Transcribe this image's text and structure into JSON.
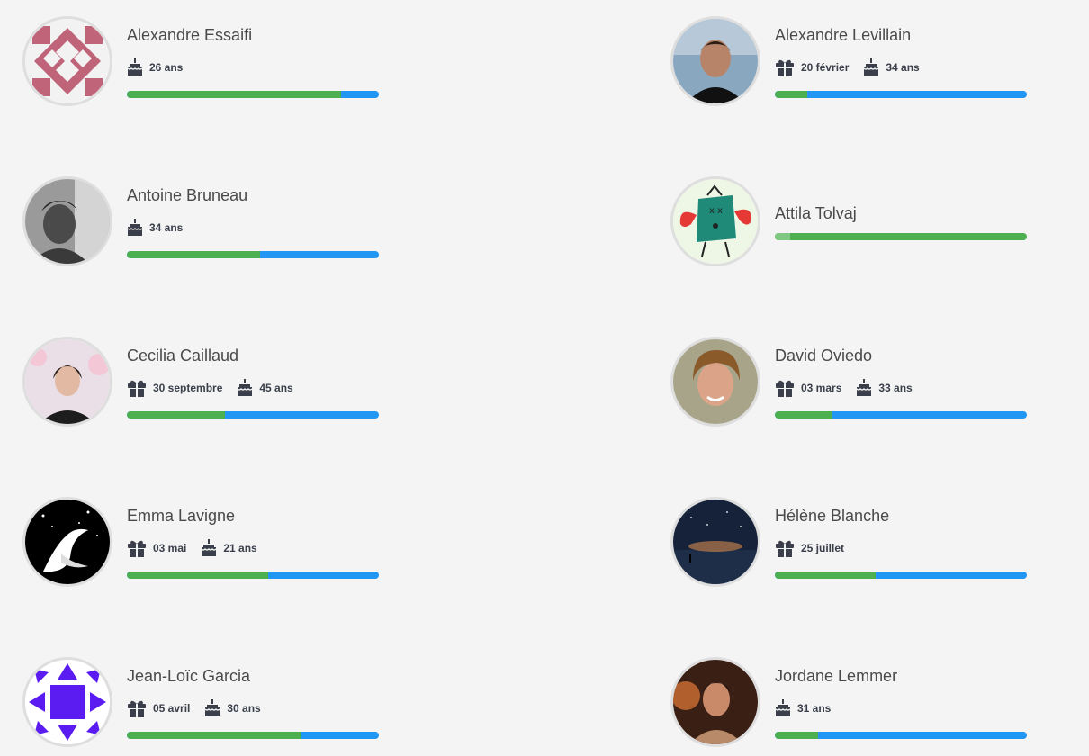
{
  "people": [
    {
      "name": "Alexandre Essaifi",
      "birthday": "",
      "age": "26 ans",
      "progress": 0.85
    },
    {
      "name": "Alexandre Levillain",
      "birthday": "20 février",
      "age": "34 ans",
      "progress": 0.13
    },
    {
      "name": "Antoine Bruneau",
      "birthday": "",
      "age": "34 ans",
      "progress": 0.53
    },
    {
      "name": "Attila Tolvaj",
      "birthday": "",
      "age": "",
      "progress": 1.0
    },
    {
      "name": "Cecilia Caillaud",
      "birthday": "30 septembre",
      "age": "45 ans",
      "progress": 0.39
    },
    {
      "name": "David Oviedo",
      "birthday": "03 mars",
      "age": "33 ans",
      "progress": 0.23
    },
    {
      "name": "Emma Lavigne",
      "birthday": "03 mai",
      "age": "21 ans",
      "progress": 0.56
    },
    {
      "name": "Hélène Blanche",
      "birthday": "25 juillet",
      "age": "",
      "progress": 0.4
    },
    {
      "name": "Jean-Loïc Garcia",
      "birthday": "05 avril",
      "age": "30 ans",
      "progress": 0.69
    },
    {
      "name": "Jordane Lemmer",
      "birthday": "",
      "age": "31 ans",
      "progress": 0.17
    }
  ],
  "colors": {
    "progress_done": "#4caf50",
    "progress_remaining": "#2196f3",
    "icon": "#3a3f4b"
  },
  "icons": {
    "birthday": "gift-icon",
    "age": "cake-icon"
  }
}
